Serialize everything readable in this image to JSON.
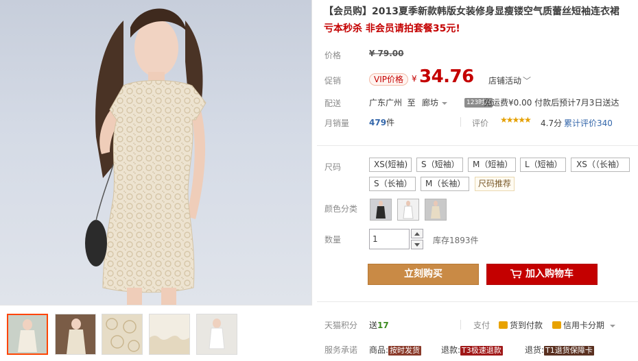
{
  "product": {
    "title": "【会员购】2013夏季新款韩版女装修身显瘦镂空气质蕾丝短袖连衣裙",
    "subtitle": "亏本秒杀 非会员请拍套餐35元!"
  },
  "price": {
    "label": "价格",
    "original": "¥ 79.00"
  },
  "promo": {
    "label": "促销",
    "vip_tag": "VIP价格",
    "currency": "¥",
    "price": "34.76",
    "shop_activity": "店铺活动"
  },
  "shipping": {
    "label": "配送",
    "from": "广东广州",
    "to_word": "至",
    "dest": "廊坊",
    "time_badge": "123时效",
    "info": "免运费¥0.00 付款后预计7月3日送达"
  },
  "sales": {
    "label": "月销量",
    "count": "479",
    "unit": "件",
    "rating_label": "评价",
    "stars": "★★★★★",
    "score": "4.7分",
    "reviews": "累计评价340"
  },
  "sizes": {
    "label": "尺码",
    "options": [
      "XS(短袖)",
      "S（短袖）",
      "M（短袖）",
      "L（短袖）",
      "XS（（长袖）",
      "S（长袖）",
      "M（长袖）"
    ],
    "recommend": "尺码推荐"
  },
  "colors": {
    "label": "颜色分类",
    "swatches": [
      "black-dress",
      "white-dress",
      "beige-dress"
    ]
  },
  "quantity": {
    "label": "数量",
    "value": "1",
    "stock": "库存1893件"
  },
  "actions": {
    "buy_now": "立刻购买",
    "add_to_cart": "加入购物车"
  },
  "points": {
    "label": "天猫积分",
    "prefix": "送",
    "value": "17"
  },
  "payment": {
    "label": "支付",
    "cod": "货到付款",
    "installment": "信用卡分期"
  },
  "service": {
    "label": "服务承诺",
    "goods_prefix": "商品:",
    "goods_tag": "按时发货",
    "refund_prefix": "退款:",
    "refund_tag": "T3极速退款",
    "return_prefix": "退货:",
    "return_tag": "T1退货保障卡"
  },
  "colors_palette": {
    "accent_red": "#c40000",
    "buy_orange": "#c98a45",
    "link_blue": "#3366aa"
  }
}
